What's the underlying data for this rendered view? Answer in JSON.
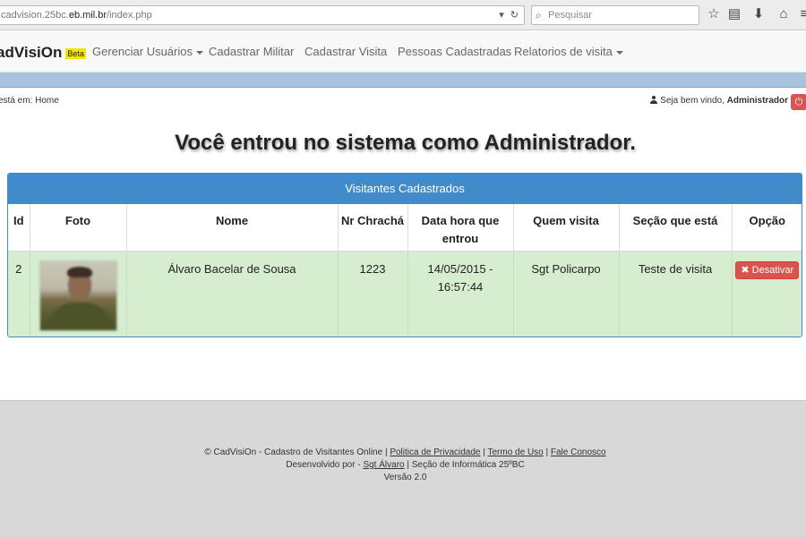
{
  "browser": {
    "url_prefix": "cadvision.25bc.",
    "url_host": "eb.mil.br",
    "url_path": "/index.php",
    "search_placeholder": "Pesquisar"
  },
  "navbar": {
    "brand": "adVisiOn",
    "beta": "Beta",
    "items": [
      {
        "label": "Gerenciar Usuários",
        "dropdown": true
      },
      {
        "label": "Cadastrar Militar",
        "dropdown": false
      },
      {
        "label": "Cadastrar Visita",
        "dropdown": false
      },
      {
        "label": "Pessoas Cadastradas",
        "dropdown": false
      },
      {
        "label": "Relatorios de visita",
        "dropdown": true
      }
    ]
  },
  "breadcrumb": {
    "prefix": "está em:",
    "current": "Home"
  },
  "welcome": {
    "text": "Seja bem vindo,",
    "user": "Administrador"
  },
  "headline": "Você entrou no sistema como Administrador.",
  "panel": {
    "title": "Visitantes Cadastrados",
    "columns": [
      "Id",
      "Foto",
      "Nome",
      "Nr Chrachá",
      "Data hora que entrou",
      "Quem visita",
      "Seção que está",
      "Opção"
    ],
    "rows": [
      {
        "id": "2",
        "nome": "Álvaro Bacelar de Sousa",
        "cracha": "1223",
        "data_hora": "14/05/2015 - 16:57:44",
        "quem_visita": "Sgt Policarpo",
        "secao": "Teste de visita",
        "action_label": "Desativar"
      }
    ]
  },
  "footer": {
    "copyright": "© CadVisiOn - Cadastro de Visitantes Online |",
    "links": [
      "Politica de Privacidade",
      "Termo de Uso",
      "Fale Conosco"
    ],
    "developed_by": "Desenvolvido por -",
    "developer": "Sgt Álvaro",
    "section": "| Seção de Informática 25ºBC",
    "version": "Versão 2.0"
  },
  "colors": {
    "panel_primary": "#428bca",
    "success_row": "#d6edd0",
    "danger": "#d9534f",
    "beta_badge": "#f2e500"
  }
}
